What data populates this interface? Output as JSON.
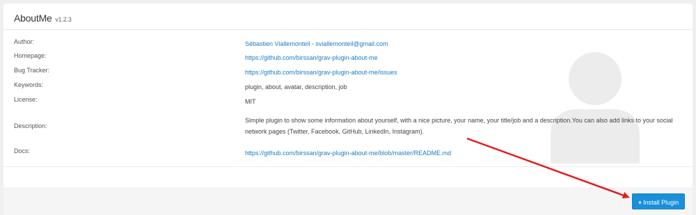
{
  "plugin": {
    "name": "AboutMe",
    "version": "v1.2.3"
  },
  "details": [
    {
      "label": "Author:",
      "value": "Sébastien Viallemonteil - sviallemonteil@gmail.com",
      "link": true
    },
    {
      "label": "Homepage:",
      "value": "https://github.com/birssan/grav-plugin-about-me",
      "link": true
    },
    {
      "label": "Bug Tracker:",
      "value": "https://github.com/birssan/grav-plugin-about-me/issues",
      "link": true
    },
    {
      "label": "Keywords:",
      "value": "plugin, about, avatar, description, job",
      "link": false
    },
    {
      "label": "License:",
      "value": "MIT",
      "link": false
    },
    {
      "label": "Description:",
      "value": "Simple plugin to show some information about yourself, with a nice picture, your name, your title/job and a description.You can also add links to your social network pages (Twitter, Facebook, GitHub, LinkedIn, Instagram).",
      "link": false
    },
    {
      "label": "Docs:",
      "value": "https://github.com/birssan/grav-plugin-about-me/blob/master/README.md",
      "link": true
    }
  ],
  "actions": {
    "install_icon": "plus-icon",
    "install_label": "Install Plugin"
  },
  "colors": {
    "link": "#1a7bc7",
    "button": "#1a8fd9",
    "annotation_arrow": "#e31b1b"
  }
}
